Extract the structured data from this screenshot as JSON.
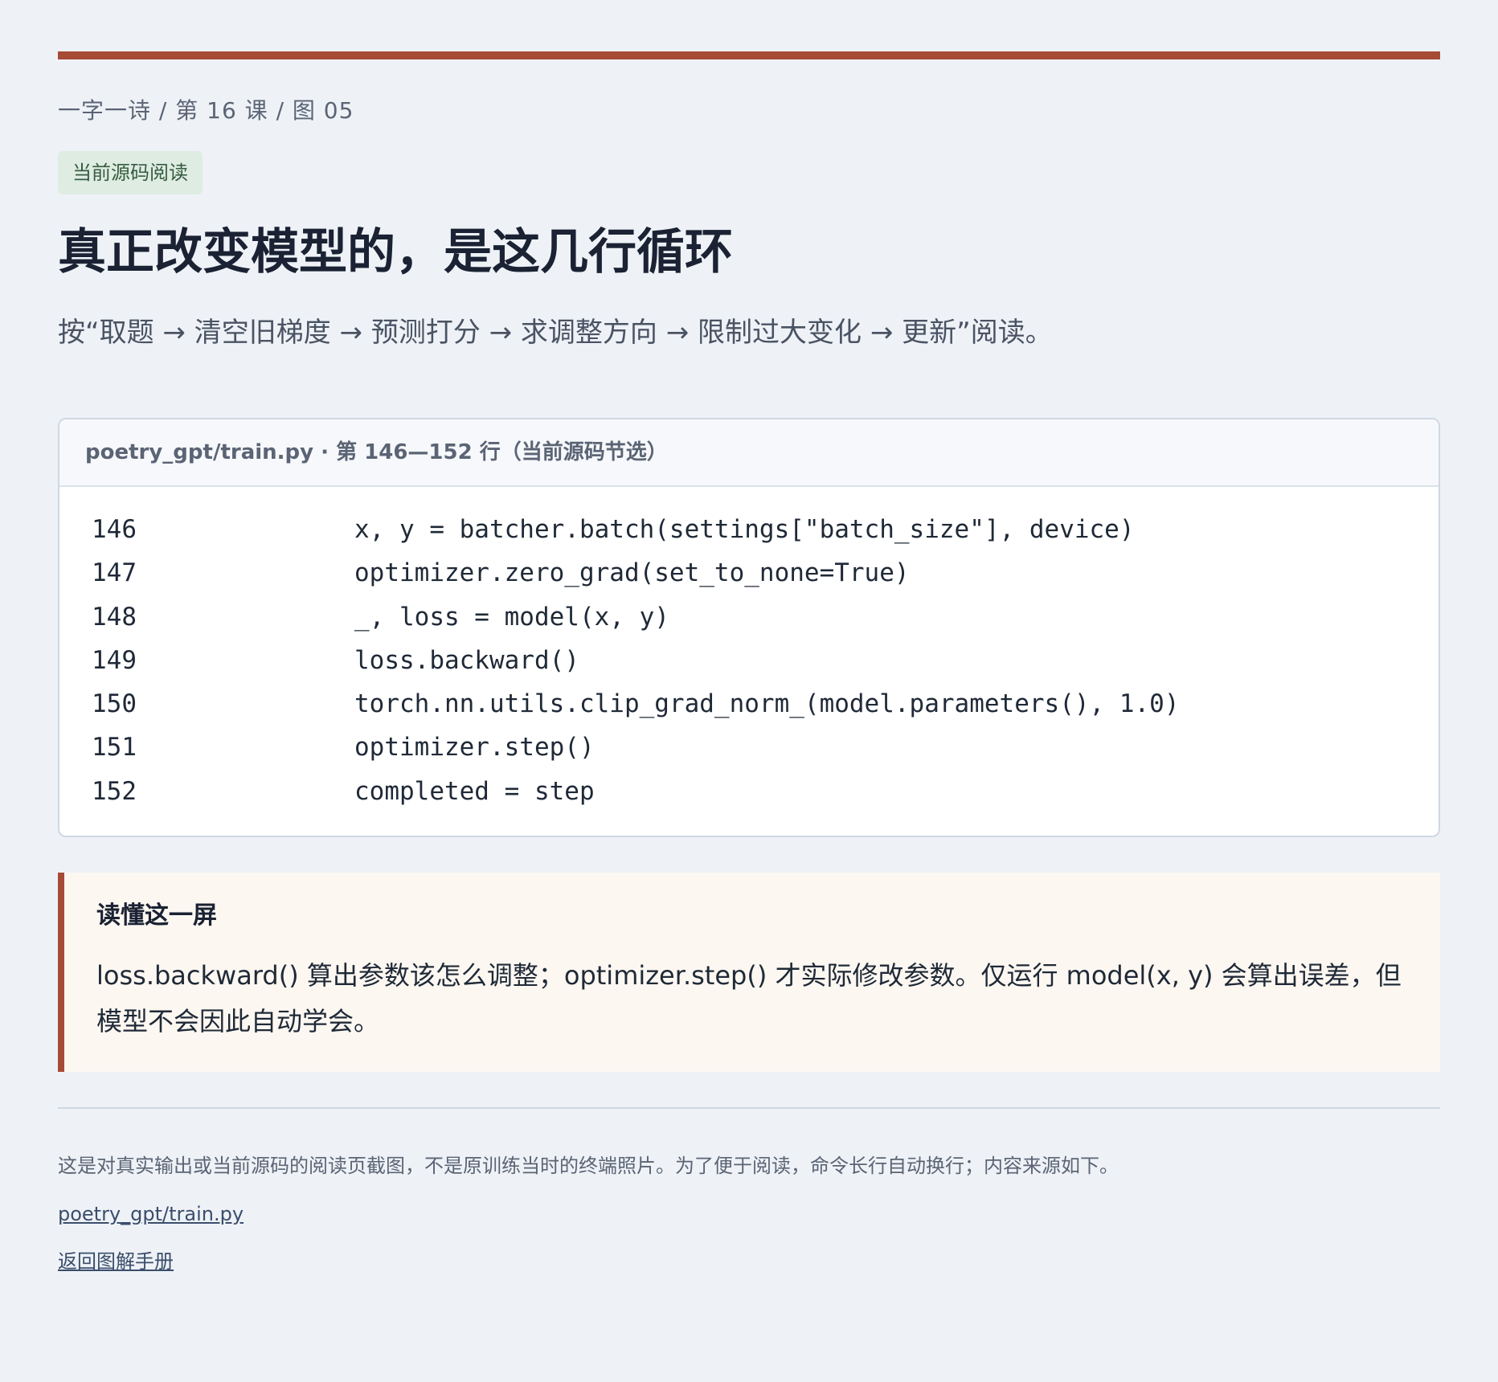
{
  "breadcrumb": "一字一诗 / 第 16 课 / 图 05",
  "badge": "当前源码阅读",
  "title": "真正改变模型的，是这几行循环",
  "subtitle": "按“取题 → 清空旧梯度 → 预测打分 → 求调整方向 → 限制过大变化 → 更新”阅读。",
  "code_card": {
    "header": "poetry_gpt/train.py · 第 146—152 行（当前源码节选）",
    "lines": [
      {
        "no": "146",
        "code": "x, y = batcher.batch(settings[\"batch_size\"], device)"
      },
      {
        "no": "147",
        "code": "optimizer.zero_grad(set_to_none=True)"
      },
      {
        "no": "148",
        "code": "_, loss = model(x, y)"
      },
      {
        "no": "149",
        "code": "loss.backward()"
      },
      {
        "no": "150",
        "code": "torch.nn.utils.clip_grad_norm_(model.parameters(), 1.0)"
      },
      {
        "no": "151",
        "code": "optimizer.step()"
      },
      {
        "no": "152",
        "code": "completed = step"
      }
    ]
  },
  "note": {
    "title": "读懂这一屏",
    "text": "loss.backward() 算出参数该怎么调整；optimizer.step() 才实际修改参数。仅运行 model(x, y) 会算出误差，但模型不会因此自动学会。"
  },
  "footer": {
    "text": "这是对真实输出或当前源码的阅读页截图，不是原训练当时的终端照片。为了便于阅读，命令长行自动换行；内容来源如下。",
    "source_link": "poetry_gpt/train.py",
    "back_link": "返回图解手册"
  },
  "colors": {
    "accent": "#a64b36",
    "background": "#eef2f7",
    "badge_bg": "#dfece2",
    "note_bg": "#fcf7f1"
  }
}
